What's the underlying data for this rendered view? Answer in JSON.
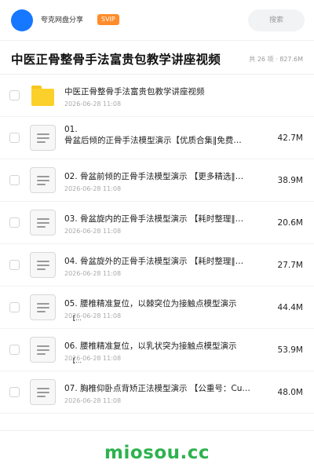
{
  "header": {
    "share_name": "夸克网盘分享",
    "badge": "SVIP",
    "search_placeholder": "搜索"
  },
  "folder": {
    "title": "中医正骨整骨手法富贵包教学讲座视频",
    "meta": "共 26 项 · 827.6M"
  },
  "items": [
    {
      "type": "folder",
      "name": "中医正骨整骨手法富贵包教学讲座视频",
      "date": "2026-06-28 11:08",
      "size": ""
    },
    {
      "type": "file",
      "name_line1": "01.",
      "name_line2": "骨盆后倾的正骨手法模型演示【优质合集‖免费…",
      "size": "42.7M"
    },
    {
      "type": "file",
      "name": "02. 骨盆前倾的正骨手法模型演示 【更多精选‖…",
      "date": "2026-06-28 11:08",
      "size": "38.9M"
    },
    {
      "type": "file",
      "name": "03. 骨盆旋内的正骨手法模型演示 【耗时整理‖…",
      "date": "2026-06-28 11:08",
      "size": "20.6M"
    },
    {
      "type": "file",
      "name": "04. 骨盆旋外的正骨手法模型演示 【耗时整理‖…",
      "date": "2026-06-28 11:08",
      "size": "27.7M"
    },
    {
      "type": "file",
      "name": "05. 腰椎精准复位，以棘突位为接触点模型演示",
      "date": "2026-06-28 11:08",
      "size": "44.4M",
      "trail": "【…"
    },
    {
      "type": "file",
      "name": "06. 腰椎精准复位，以乳状突为接触点模型演示",
      "date": "2026-06-28 11:08",
      "size": "53.9M",
      "trail": "【…"
    },
    {
      "type": "file",
      "name": "07. 胸椎仰卧点背矫正法模型演示 【公重号：Cu…",
      "date": "2026-06-28 11:08",
      "size": "48.0M"
    }
  ],
  "watermark": "miosou.cc",
  "colors": {
    "accent": "#1677ff",
    "badge": "#ff8c2b",
    "folder": "#fcd02a",
    "watermark": "#2db24f"
  }
}
